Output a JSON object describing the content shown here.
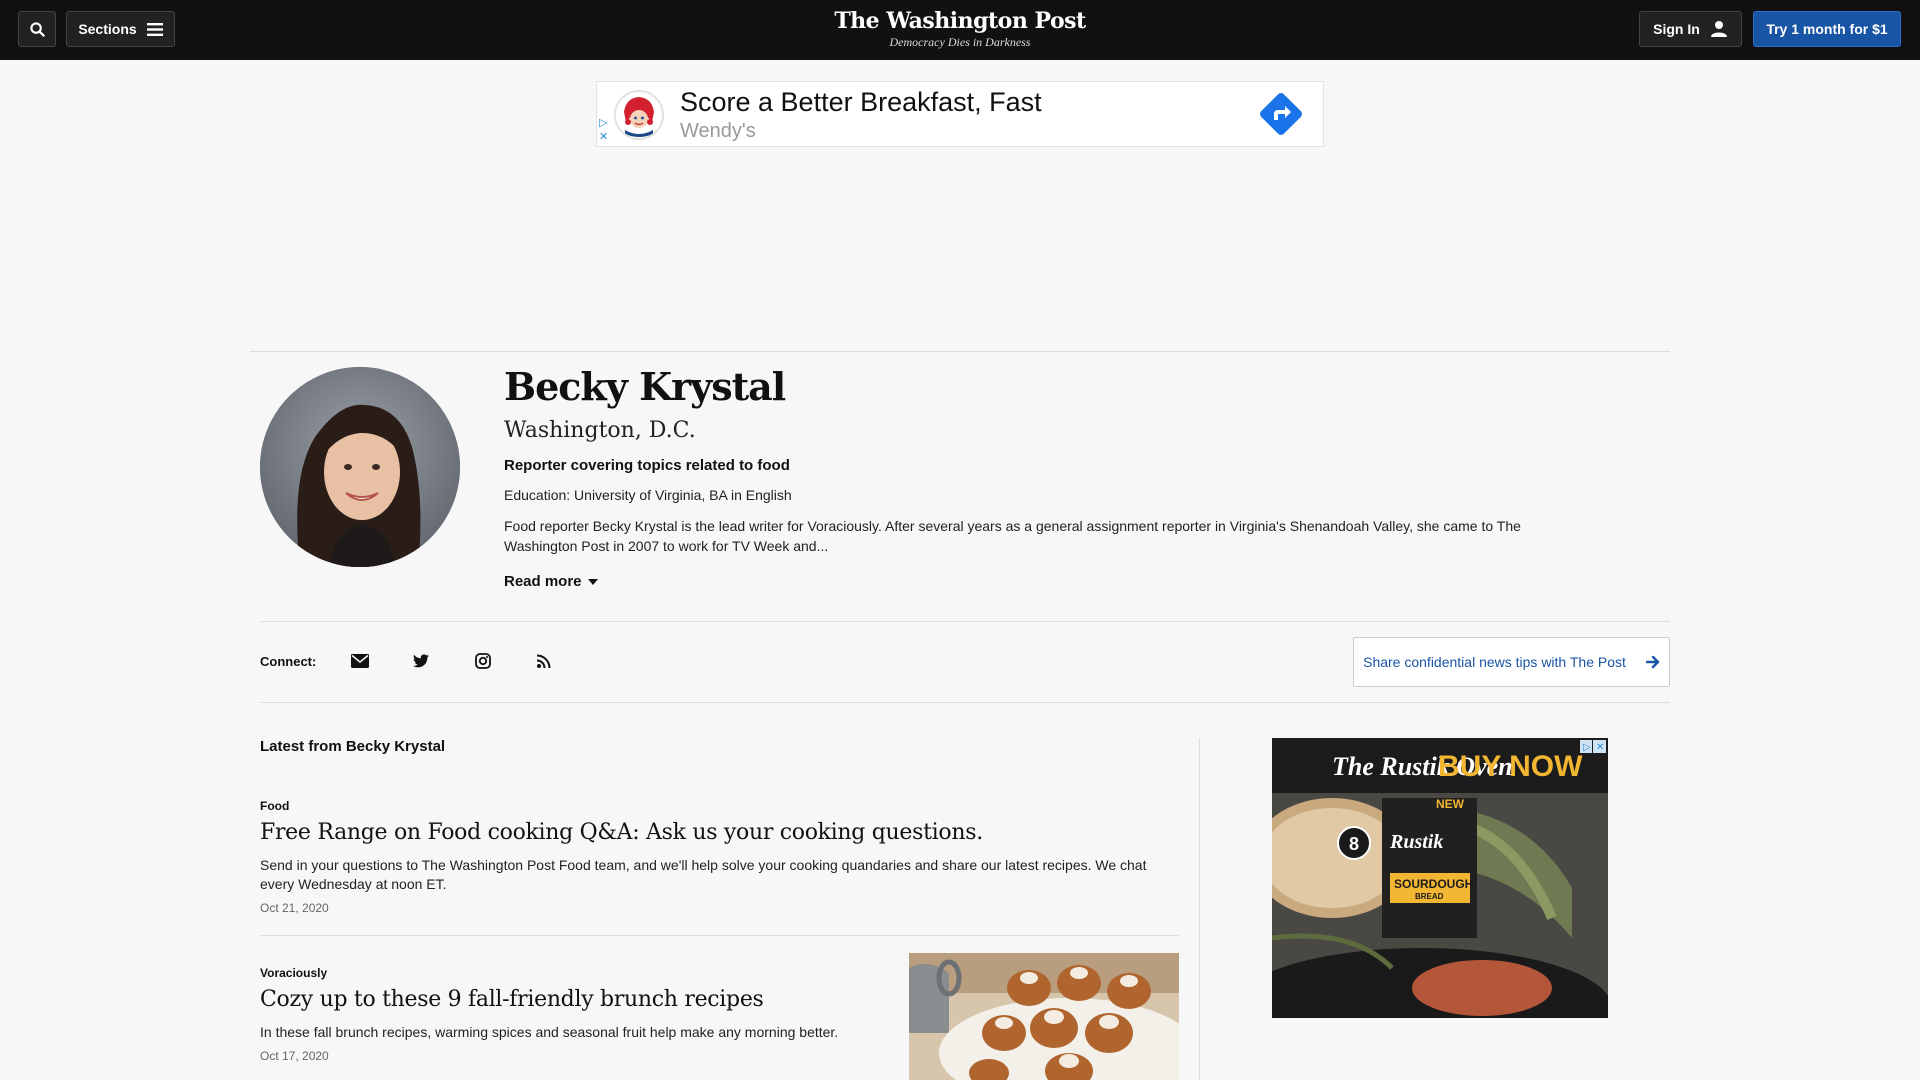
{
  "header": {
    "sections_label": "Sections",
    "logo": "The Washington Post",
    "tagline": "Democracy Dies in Darkness",
    "signin_label": "Sign In",
    "subscribe_label": "Try 1 month for $1"
  },
  "top_ad": {
    "headline": "Score a Better Breakfast, Fast",
    "brand": "Wendy's",
    "colors": {
      "cta": "#1a73e8"
    }
  },
  "profile": {
    "name": "Becky Krystal",
    "location": "Washington, D.C.",
    "role": "Reporter covering topics related to food",
    "education": "Education: University of Virginia, BA in English",
    "bio": "Food reporter Becky Krystal is the lead writer for Voraciously. After several years as a general assignment reporter in Virginia's Shenandoah Valley, she came to The Washington Post in 2007 to work for TV Week and...",
    "read_more": "Read more"
  },
  "connect": {
    "label": "Connect:",
    "icons": [
      "email-icon",
      "twitter-icon",
      "instagram-icon",
      "rss-icon"
    ],
    "tips_label": "Share confidential news tips with The Post"
  },
  "latest": {
    "heading": "Latest from Becky Krystal",
    "articles": [
      {
        "kicker": "Food",
        "headline": "Free Range on Food cooking Q&A: Ask us your cooking questions.",
        "blurb": "Send in your questions to The Washington Post Food team, and we'll help solve your cooking quandaries and share our latest recipes. We chat every Wednesday at noon ET.",
        "date": "Oct 21, 2020"
      },
      {
        "kicker": "Voraciously",
        "headline": "Cozy up to these 9 fall-friendly brunch recipes",
        "blurb": "In these fall brunch recipes, warming spices and seasonal fruit help make any morning better.",
        "date": "Oct 17, 2020"
      }
    ]
  },
  "side_ad": {
    "brand": "The Rustik Oven",
    "cta": "BUY NOW",
    "badge": "NEW",
    "product": "SOURDOUGH",
    "product_sub": "BREAD"
  },
  "colors": {
    "header_bg": "#111111",
    "subscribe": "#1955a5",
    "page_bg": "#f7f7f7"
  }
}
